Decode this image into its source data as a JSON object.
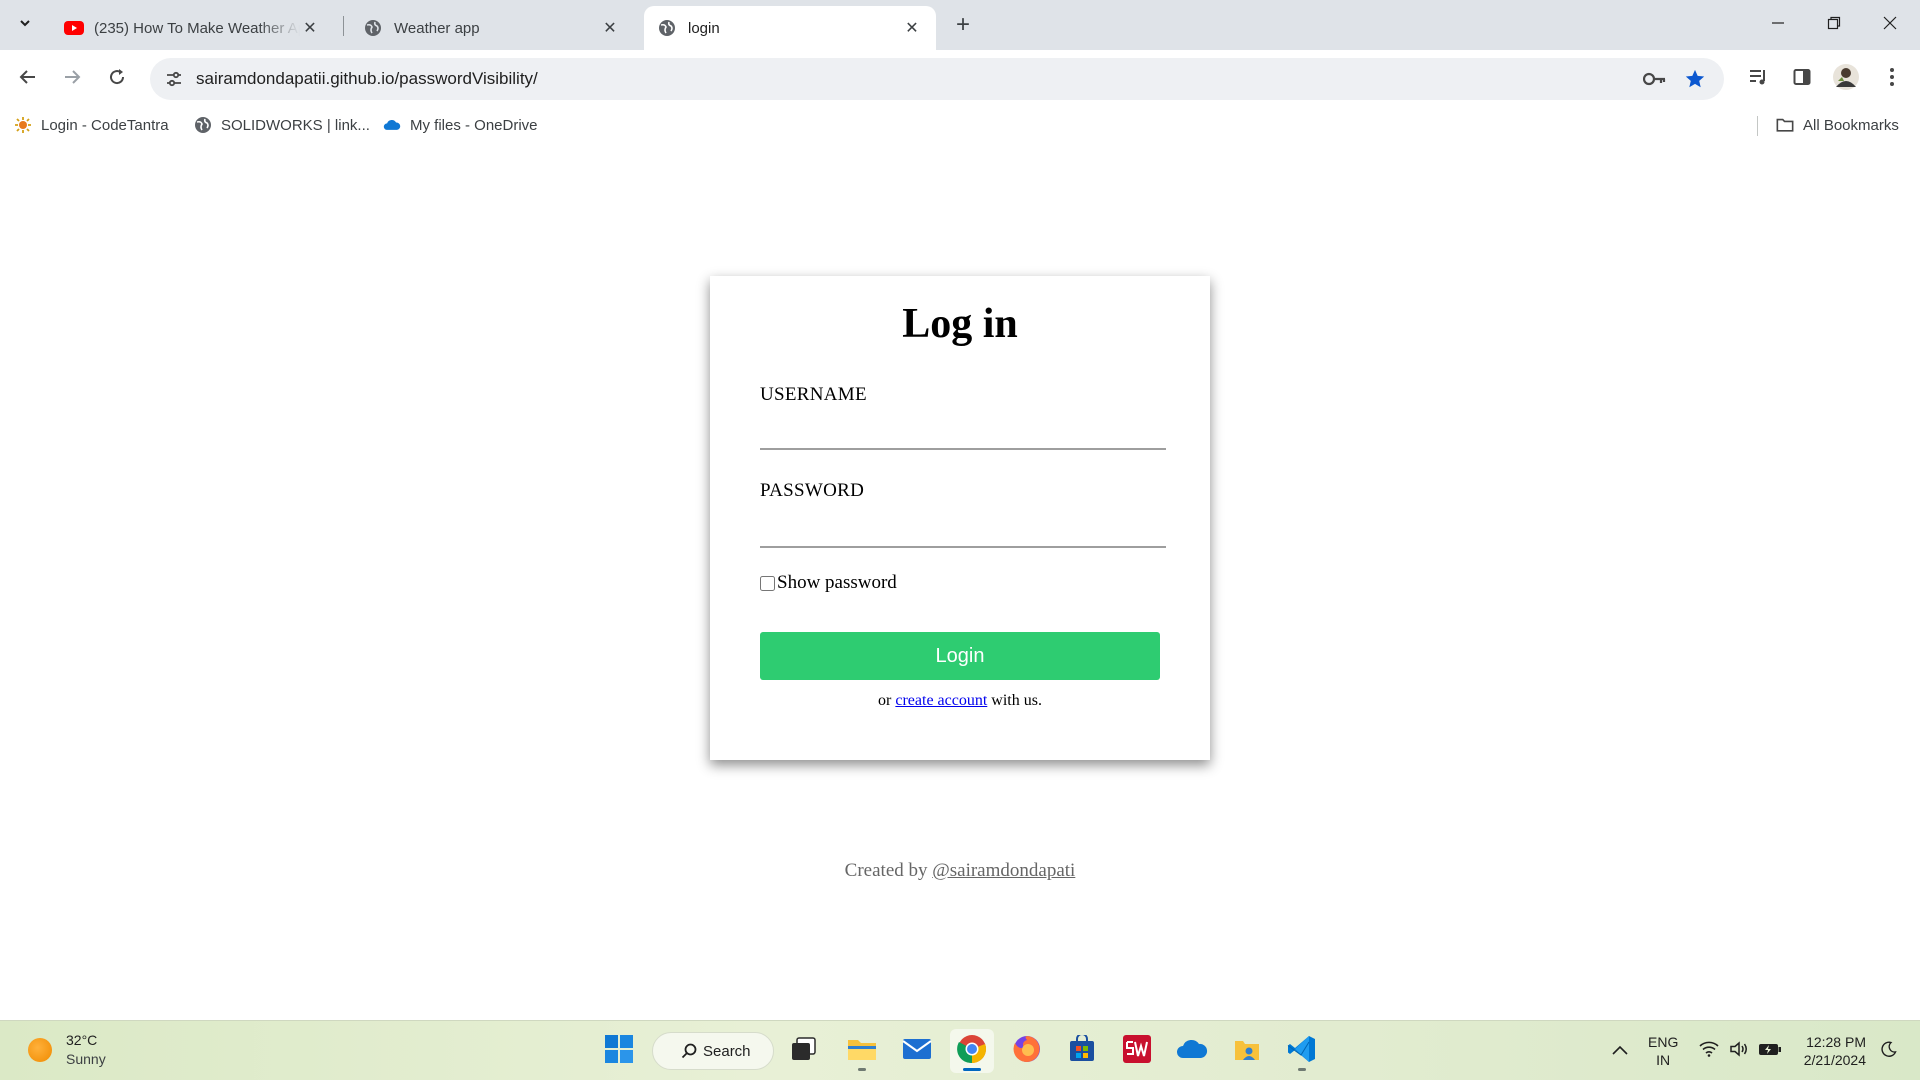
{
  "browser": {
    "tabs": [
      {
        "title": "(235) How To Make Weather Ap",
        "favicon": "youtube-icon",
        "active": false
      },
      {
        "title": "Weather app",
        "favicon": "globe-icon",
        "active": false
      },
      {
        "title": "login",
        "favicon": "globe-icon",
        "active": true
      }
    ],
    "url": "sairamdondapatii.github.io/passwordVisibility/",
    "bookmarks": [
      {
        "label": "Login - CodeTantra",
        "icon": "codetantra-icon"
      },
      {
        "label": "SOLIDWORKS | link...",
        "icon": "globe-icon"
      },
      {
        "label": "My files - OneDrive",
        "icon": "onedrive-icon"
      }
    ],
    "all_bookmarks_label": "All Bookmarks"
  },
  "login": {
    "heading": "Log in",
    "username_label": "USERNAME",
    "username_value": "",
    "password_label": "PASSWORD",
    "password_value": "",
    "show_password_label": "Show password",
    "show_password_checked": false,
    "login_button": "Login",
    "alt_prefix": "or",
    "alt_link": "create account",
    "alt_suffix": "with us."
  },
  "footer": {
    "prefix": "Created by",
    "handle": "@sairamdondapati"
  },
  "taskbar": {
    "weather_temp": "32°C",
    "weather_condition": "Sunny",
    "search_label": "Search",
    "language_line1": "ENG",
    "language_line2": "IN",
    "time": "12:28 PM",
    "date": "2/21/2024"
  },
  "colors": {
    "login_button": "#2ecc71",
    "link": "#0000ee",
    "bookmark_star": "#0b57d0"
  }
}
